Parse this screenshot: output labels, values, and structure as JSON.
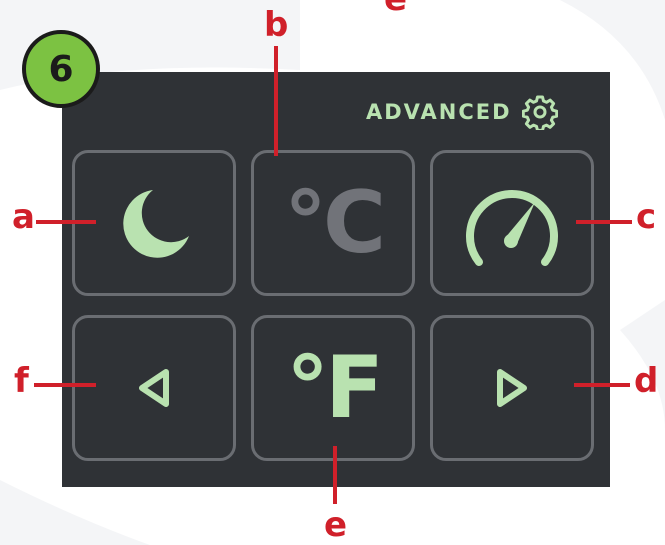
{
  "step_badge": "6",
  "header": {
    "advanced_label": "ADVANCED",
    "settings_icon": "gear-icon"
  },
  "tiles": [
    {
      "callout": "a",
      "icon": "moon-icon"
    },
    {
      "callout": "b",
      "label": "°C"
    },
    {
      "callout": "c",
      "icon": "speedometer-icon"
    },
    {
      "callout": "f",
      "icon": "triangle-left-icon"
    },
    {
      "callout": "e",
      "label": "°F"
    },
    {
      "callout": "d",
      "icon": "triangle-right-icon"
    }
  ],
  "top_partial_callout": "e",
  "colors": {
    "panel": "#2f3236",
    "active": "#b9e2b0",
    "inactive": "#717379",
    "tile_border": "#6a6d72",
    "callout": "#d0202a",
    "badge": "#7cc242"
  }
}
